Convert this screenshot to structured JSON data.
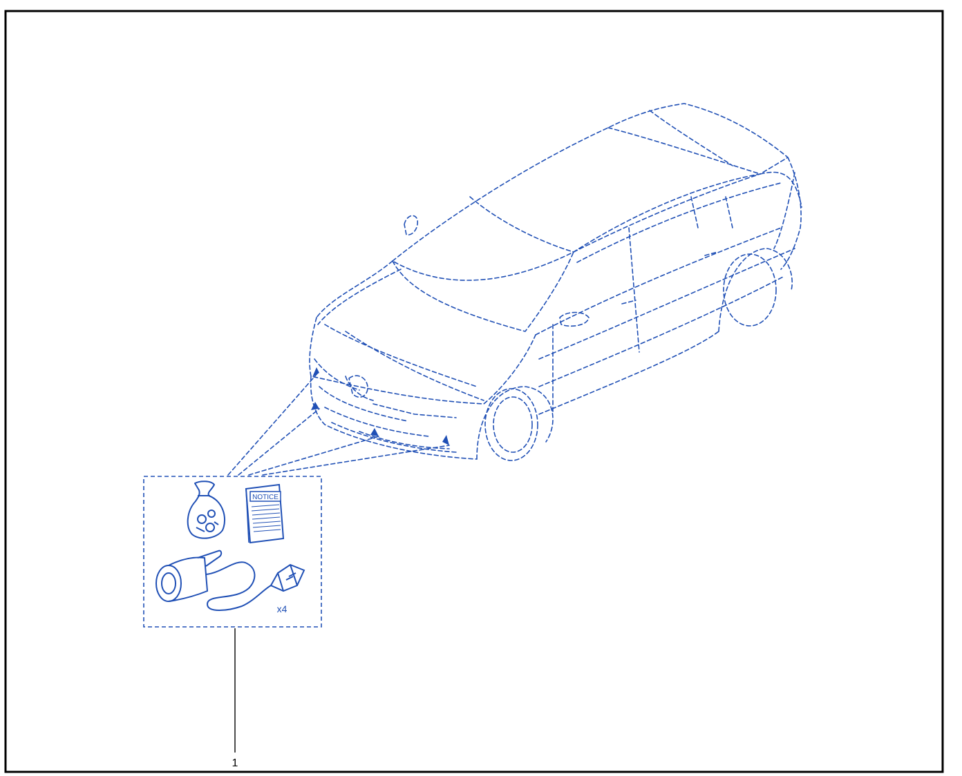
{
  "diagram": {
    "line_color": "#1f4fb5",
    "frame_color": "#000000",
    "background": "#ffffff",
    "kit": {
      "booklet_label": "NOTICE",
      "quantity_label": "x4",
      "items": [
        "hardware-bag-icon",
        "instruction-booklet-icon",
        "parking-sensor-icon",
        "wiring-connector-icon"
      ]
    },
    "callouts": [
      {
        "number": "1",
        "refers_to": "kit"
      }
    ]
  }
}
